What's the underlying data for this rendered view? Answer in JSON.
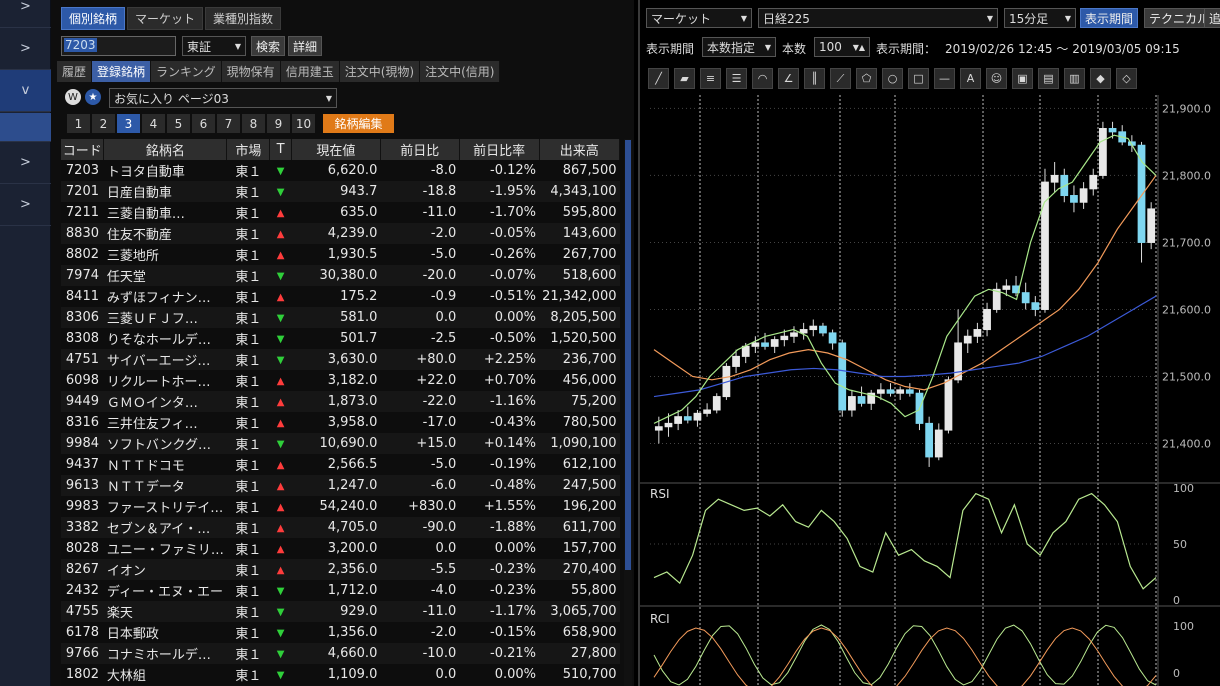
{
  "nav": {
    "items": [
      ">",
      ">",
      "v",
      "",
      ">",
      ">"
    ]
  },
  "left": {
    "tabs": [
      "個別銘柄",
      "マーケット",
      "業種別指数"
    ],
    "code_value": "7203",
    "market_select": "東証",
    "search_btn": "検索",
    "detail_btn": "詳細",
    "subtabs": [
      "履歴",
      "登録銘柄",
      "ランキング",
      "現物保有",
      "信用建玉",
      "注文中(現物)",
      "注文中(信用)"
    ],
    "favorites_select": "お気に入り ページ03",
    "pages": [
      "1",
      "2",
      "3",
      "4",
      "5",
      "6",
      "7",
      "8",
      "9",
      "10"
    ],
    "edit_btn": "銘柄編集"
  },
  "table": {
    "headers": [
      "コード",
      "銘柄名",
      "市場",
      "T",
      "現在値",
      "前日比",
      "前日比率",
      "出来高"
    ],
    "rows": [
      {
        "code": "7203",
        "name": "トヨタ自動車",
        "market": "東１",
        "dir": "down",
        "price": "6,620.0",
        "chg": "-8.0",
        "pct": "-0.12%",
        "vol": "867,500"
      },
      {
        "code": "7201",
        "name": "日産自動車",
        "market": "東１",
        "dir": "down",
        "price": "943.7",
        "chg": "-18.8",
        "pct": "-1.95%",
        "vol": "4,343,100"
      },
      {
        "code": "7211",
        "name": "三菱自動車…",
        "market": "東１",
        "dir": "up",
        "price": "635.0",
        "chg": "-11.0",
        "pct": "-1.70%",
        "vol": "595,800"
      },
      {
        "code": "8830",
        "name": "住友不動産",
        "market": "東１",
        "dir": "up",
        "price": "4,239.0",
        "chg": "-2.0",
        "pct": "-0.05%",
        "vol": "143,600"
      },
      {
        "code": "8802",
        "name": "三菱地所",
        "market": "東１",
        "dir": "up",
        "price": "1,930.5",
        "chg": "-5.0",
        "pct": "-0.26%",
        "vol": "267,700"
      },
      {
        "code": "7974",
        "name": "任天堂",
        "market": "東１",
        "dir": "down",
        "price": "30,380.0",
        "chg": "-20.0",
        "pct": "-0.07%",
        "vol": "518,600"
      },
      {
        "code": "8411",
        "name": "みずほフィナン…",
        "market": "東１",
        "dir": "up",
        "price": "175.2",
        "chg": "-0.9",
        "pct": "-0.51%",
        "vol": "21,342,000"
      },
      {
        "code": "8306",
        "name": "三菱ＵＦＪフ…",
        "market": "東１",
        "dir": "down",
        "price": "581.0",
        "chg": "0.0",
        "pct": "0.00%",
        "vol": "8,205,500"
      },
      {
        "code": "8308",
        "name": "りそなホールデ…",
        "market": "東１",
        "dir": "down",
        "price": "501.7",
        "chg": "-2.5",
        "pct": "-0.50%",
        "vol": "1,520,500"
      },
      {
        "code": "4751",
        "name": "サイバーエージ…",
        "market": "東１",
        "dir": "down",
        "price": "3,630.0",
        "chg": "+80.0",
        "pct": "+2.25%",
        "vol": "236,700"
      },
      {
        "code": "6098",
        "name": "リクルートホー…",
        "market": "東１",
        "dir": "up",
        "price": "3,182.0",
        "chg": "+22.0",
        "pct": "+0.70%",
        "vol": "456,000"
      },
      {
        "code": "9449",
        "name": "ＧＭＯインタ…",
        "market": "東１",
        "dir": "up",
        "price": "1,873.0",
        "chg": "-22.0",
        "pct": "-1.16%",
        "vol": "75,200"
      },
      {
        "code": "8316",
        "name": "三井住友フィ…",
        "market": "東１",
        "dir": "up",
        "price": "3,958.0",
        "chg": "-17.0",
        "pct": "-0.43%",
        "vol": "780,500"
      },
      {
        "code": "9984",
        "name": "ソフトバンクグ…",
        "market": "東１",
        "dir": "down",
        "price": "10,690.0",
        "chg": "+15.0",
        "pct": "+0.14%",
        "vol": "1,090,100"
      },
      {
        "code": "9437",
        "name": "ＮＴＴドコモ",
        "market": "東１",
        "dir": "up",
        "price": "2,566.5",
        "chg": "-5.0",
        "pct": "-0.19%",
        "vol": "612,100"
      },
      {
        "code": "9613",
        "name": "ＮＴＴデータ",
        "market": "東１",
        "dir": "up",
        "price": "1,247.0",
        "chg": "-6.0",
        "pct": "-0.48%",
        "vol": "247,500"
      },
      {
        "code": "9983",
        "name": "ファーストリテイ…",
        "market": "東１",
        "dir": "up",
        "price": "54,240.0",
        "chg": "+830.0",
        "pct": "+1.55%",
        "vol": "196,200"
      },
      {
        "code": "3382",
        "name": "セブン＆アイ・…",
        "market": "東１",
        "dir": "up",
        "price": "4,705.0",
        "chg": "-90.0",
        "pct": "-1.88%",
        "vol": "611,700"
      },
      {
        "code": "8028",
        "name": "ユニー・ファミリ…",
        "market": "東１",
        "dir": "up",
        "price": "3,200.0",
        "chg": "0.0",
        "pct": "0.00%",
        "vol": "157,700"
      },
      {
        "code": "8267",
        "name": "イオン",
        "market": "東１",
        "dir": "up",
        "price": "2,356.0",
        "chg": "-5.5",
        "pct": "-0.23%",
        "vol": "270,400"
      },
      {
        "code": "2432",
        "name": "ディー・エヌ・エー",
        "market": "東１",
        "dir": "down",
        "price": "1,712.0",
        "chg": "-4.0",
        "pct": "-0.23%",
        "vol": "55,800"
      },
      {
        "code": "4755",
        "name": "楽天",
        "market": "東１",
        "dir": "down",
        "price": "929.0",
        "chg": "-11.0",
        "pct": "-1.17%",
        "vol": "3,065,700"
      },
      {
        "code": "6178",
        "name": "日本郵政",
        "market": "東１",
        "dir": "down",
        "price": "1,356.0",
        "chg": "-2.0",
        "pct": "-0.15%",
        "vol": "658,900"
      },
      {
        "code": "9766",
        "name": "コナミホールデ…",
        "market": "東１",
        "dir": "down",
        "price": "4,660.0",
        "chg": "-10.0",
        "pct": "-0.21%",
        "vol": "27,800"
      },
      {
        "code": "1802",
        "name": "大林組",
        "market": "東１",
        "dir": "down",
        "price": "1,109.0",
        "chg": "0.0",
        "pct": "0.00%",
        "vol": "510,700"
      }
    ]
  },
  "right": {
    "market_select": "マーケット",
    "index_select": "日経225",
    "interval_select": "15分足",
    "tab_period": "表示期間",
    "tab_technical": "テクニカル",
    "tab_more": "追",
    "period_label": "表示期間",
    "period_mode": "本数指定",
    "count_label": "本数",
    "count_value": "100",
    "range_label": "表示期間：",
    "range_value": "2019/02/26 12:45 〜 2019/03/05 09:15",
    "price_ticks": [
      "21,900.0",
      "21,800.0",
      "21,700.0",
      "21,600.0",
      "21,500.0",
      "21,400.0"
    ],
    "rsi_label": "RSI",
    "rsi_ticks": [
      "100",
      "50",
      "0"
    ],
    "rci_label": "RCI",
    "rci_ticks": [
      "100",
      "0"
    ],
    "tools": [
      "line-tool-icon",
      "eraser-icon",
      "hline-icon",
      "multi-hline-icon",
      "fan-icon",
      "gann-icon",
      "vline-icon",
      "trend-icon",
      "pentagon-icon",
      "circle-icon",
      "rect-icon",
      "dash-icon",
      "text-icon",
      "icon-stamp-icon",
      "icon2-icon",
      "icon3-icon",
      "icon4-icon",
      "icon5-icon",
      "icon6-icon"
    ]
  },
  "chart_data": {
    "type": "candlestick",
    "ylim": [
      21350,
      21920
    ],
    "candles": [
      [
        21420,
        21440,
        21400,
        21425
      ],
      [
        21425,
        21445,
        21410,
        21430
      ],
      [
        21430,
        21450,
        21420,
        21440
      ],
      [
        21440,
        21455,
        21430,
        21435
      ],
      [
        21435,
        21450,
        21425,
        21445
      ],
      [
        21445,
        21460,
        21440,
        21450
      ],
      [
        21450,
        21475,
        21445,
        21470
      ],
      [
        21470,
        21520,
        21465,
        21515
      ],
      [
        21515,
        21540,
        21505,
        21530
      ],
      [
        21530,
        21550,
        21520,
        21545
      ],
      [
        21545,
        21560,
        21535,
        21550
      ],
      [
        21550,
        21565,
        21540,
        21545
      ],
      [
        21545,
        21560,
        21535,
        21555
      ],
      [
        21555,
        21570,
        21545,
        21560
      ],
      [
        21560,
        21575,
        21550,
        21565
      ],
      [
        21565,
        21580,
        21555,
        21570
      ],
      [
        21570,
        21585,
        21560,
        21575
      ],
      [
        21575,
        21580,
        21560,
        21565
      ],
      [
        21565,
        21570,
        21540,
        21550
      ],
      [
        21550,
        21555,
        21440,
        21450
      ],
      [
        21450,
        21480,
        21440,
        21470
      ],
      [
        21470,
        21485,
        21455,
        21460
      ],
      [
        21460,
        21480,
        21450,
        21475
      ],
      [
        21475,
        21490,
        21465,
        21480
      ],
      [
        21480,
        21490,
        21470,
        21475
      ],
      [
        21475,
        21485,
        21465,
        21480
      ],
      [
        21480,
        21490,
        21470,
        21475
      ],
      [
        21475,
        21480,
        21420,
        21430
      ],
      [
        21430,
        21440,
        21365,
        21380
      ],
      [
        21380,
        21430,
        21375,
        21420
      ],
      [
        21420,
        21500,
        21415,
        21495
      ],
      [
        21495,
        21600,
        21490,
        21550
      ],
      [
        21550,
        21570,
        21535,
        21560
      ],
      [
        21560,
        21580,
        21550,
        21570
      ],
      [
        21570,
        21610,
        21560,
        21600
      ],
      [
        21600,
        21640,
        21595,
        21630
      ],
      [
        21630,
        21645,
        21620,
        21635
      ],
      [
        21635,
        21650,
        21620,
        21625
      ],
      [
        21625,
        21640,
        21600,
        21610
      ],
      [
        21610,
        21620,
        21590,
        21600
      ],
      [
        21600,
        21810,
        21595,
        21790
      ],
      [
        21790,
        21820,
        21775,
        21800
      ],
      [
        21800,
        21810,
        21760,
        21770
      ],
      [
        21770,
        21785,
        21745,
        21760
      ],
      [
        21760,
        21790,
        21750,
        21780
      ],
      [
        21780,
        21810,
        21770,
        21800
      ],
      [
        21800,
        21880,
        21795,
        21870
      ],
      [
        21870,
        21880,
        21855,
        21865
      ],
      [
        21865,
        21875,
        21845,
        21850
      ],
      [
        21850,
        21860,
        21835,
        21845
      ],
      [
        21845,
        21850,
        21670,
        21700
      ],
      [
        21700,
        21760,
        21690,
        21750
      ]
    ],
    "ma_short": [
      21430,
      21440,
      21450,
      21470,
      21500,
      21520,
      21540,
      21550,
      21560,
      21565,
      21570,
      21560,
      21520,
      21490,
      21480,
      21475,
      21470,
      21460,
      21440,
      21450,
      21500,
      21560,
      21590,
      21620,
      21630,
      21625,
      21615,
      21700,
      21760,
      21780,
      21790,
      21820,
      21850,
      21860,
      21855,
      21820,
      21800
    ],
    "ma_long": [
      21540,
      21520,
      21500,
      21495,
      21500,
      21510,
      21525,
      21535,
      21540,
      21535,
      21525,
      21510,
      21495,
      21485,
      21480,
      21490,
      21505,
      21520,
      21540,
      21560,
      21580,
      21600,
      21630,
      21670,
      21720,
      21760,
      21800
    ],
    "ma_mid": [
      21470,
      21475,
      21480,
      21490,
      21500,
      21505,
      21510,
      21512,
      21510,
      21505,
      21500,
      21500,
      21502,
      21505,
      21510,
      21515,
      21520,
      21530,
      21545,
      21560,
      21580,
      21600,
      21620
    ],
    "rsi": [
      20,
      25,
      15,
      40,
      80,
      90,
      85,
      80,
      82,
      75,
      85,
      70,
      65,
      80,
      70,
      55,
      30,
      25,
      60,
      40,
      45,
      35,
      30,
      20,
      80,
      95,
      90,
      60,
      85,
      50,
      40,
      60,
      70,
      90,
      95,
      85,
      70,
      30,
      10,
      20
    ]
  }
}
